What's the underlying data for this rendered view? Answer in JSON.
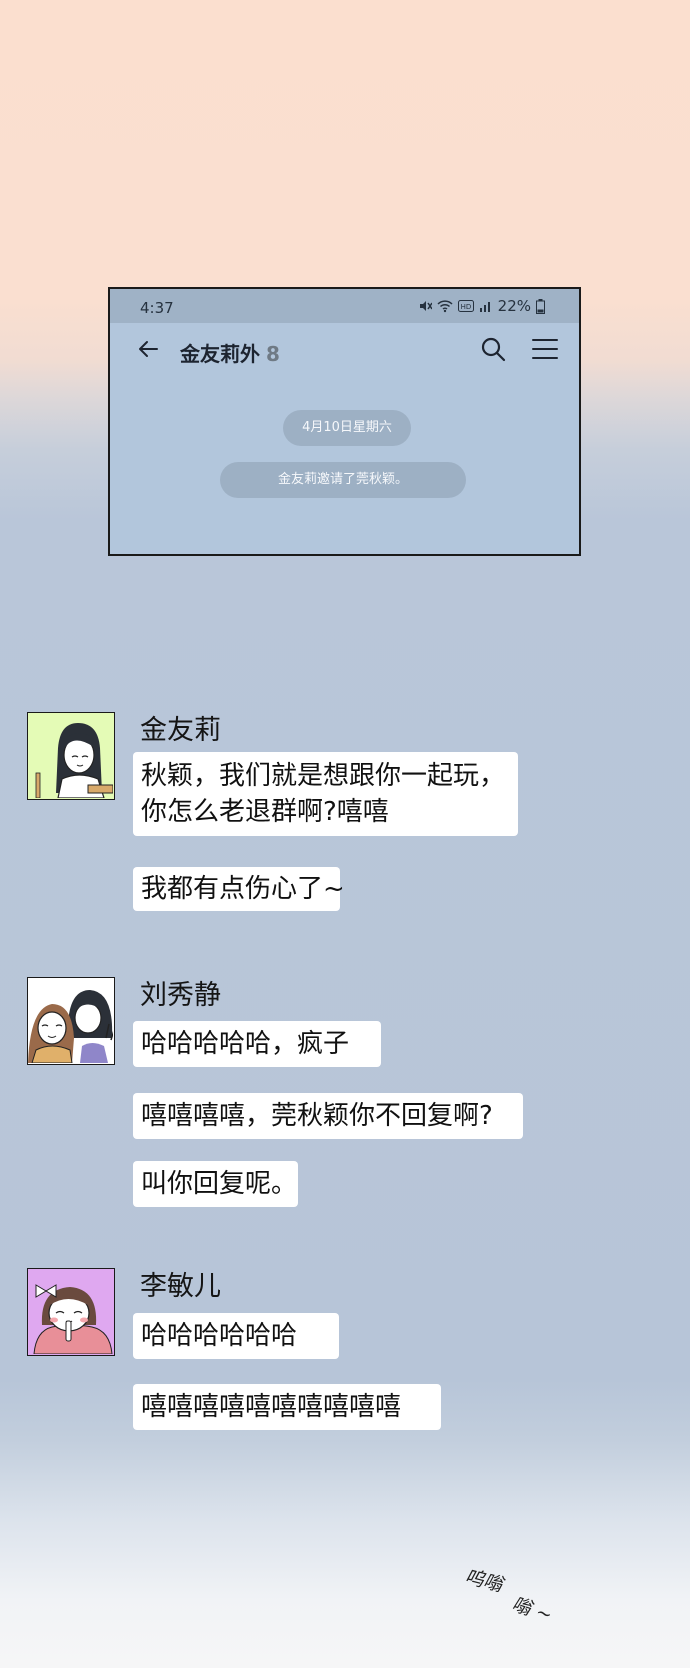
{
  "status_bar": {
    "time": "4:37",
    "battery": "22%"
  },
  "chat_header": {
    "title": "金友莉外",
    "member_count": "8"
  },
  "date_divider": "4月10日星期六",
  "system_message": "金友莉邀请了莞秋颖。",
  "messages": [
    {
      "sender": "金友莉",
      "bubbles": [
        "秋颖，我们就是想跟你一起玩，",
        "你怎么老退群啊?嘻嘻",
        "我都有点伤心了~"
      ]
    },
    {
      "sender": "刘秀静",
      "bubbles": [
        "哈哈哈哈哈，疯子",
        "嘻嘻嘻嘻，莞秋颖你不回复啊?",
        "叫你回复呢。"
      ]
    },
    {
      "sender": "李敏儿",
      "bubbles": [
        "哈哈哈哈哈哈",
        "嘻嘻嘻嘻嘻嘻嘻嘻嘻嘻"
      ]
    }
  ],
  "sound_effect": {
    "line1": "呜嗡",
    "line2": "嗡 ~"
  },
  "colors": {
    "bubble": "#ffffff",
    "phone_bg": "#b2c6dc",
    "statusbar": "#9fb2c6",
    "pill": "#9db0c4"
  }
}
